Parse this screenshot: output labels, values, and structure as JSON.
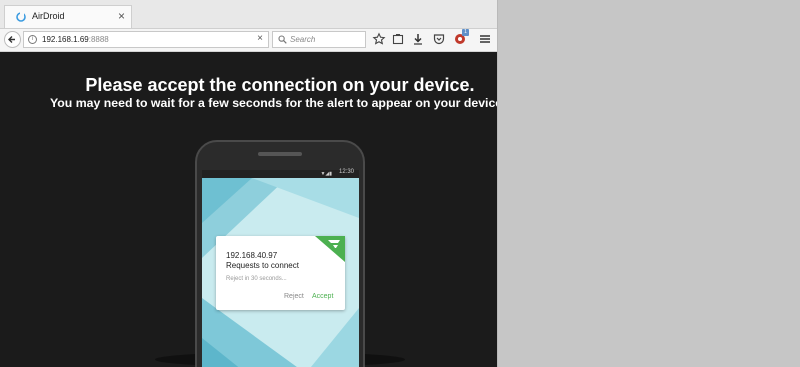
{
  "browser": {
    "tab": {
      "title": "AirDroid",
      "close_glyph": "×",
      "favicon": "airdroid-logo-icon"
    },
    "nav": {
      "back_icon": "back-arrow-icon",
      "url_host": "192.168.1.69",
      "url_port": ":8888",
      "clear_glyph": "×",
      "search_placeholder": "Search"
    },
    "toolbar_icons": [
      "bookmark-star-icon",
      "library-icon",
      "download-icon",
      "pocket-icon",
      "extension-icon",
      "menu-icon"
    ],
    "extension_badge": "1"
  },
  "page": {
    "headline": "Please accept the connection on your device.",
    "subline": "You may need to wait for a few seconds for the alert to appear on your device",
    "phone": {
      "status_time": "12:30",
      "status_icons": "▼◢▮",
      "dialog": {
        "ip": "192.168.40.97",
        "title": "Requests to connect",
        "timer": "Reject in 30 seconds...",
        "reject_label": "Reject",
        "accept_label": "Accept"
      }
    }
  },
  "colors": {
    "page_bg": "#1b1b1b",
    "accept": "#4cb050",
    "airdroid_green": "#4cb050",
    "screen_teal": "#b3e0e8"
  }
}
